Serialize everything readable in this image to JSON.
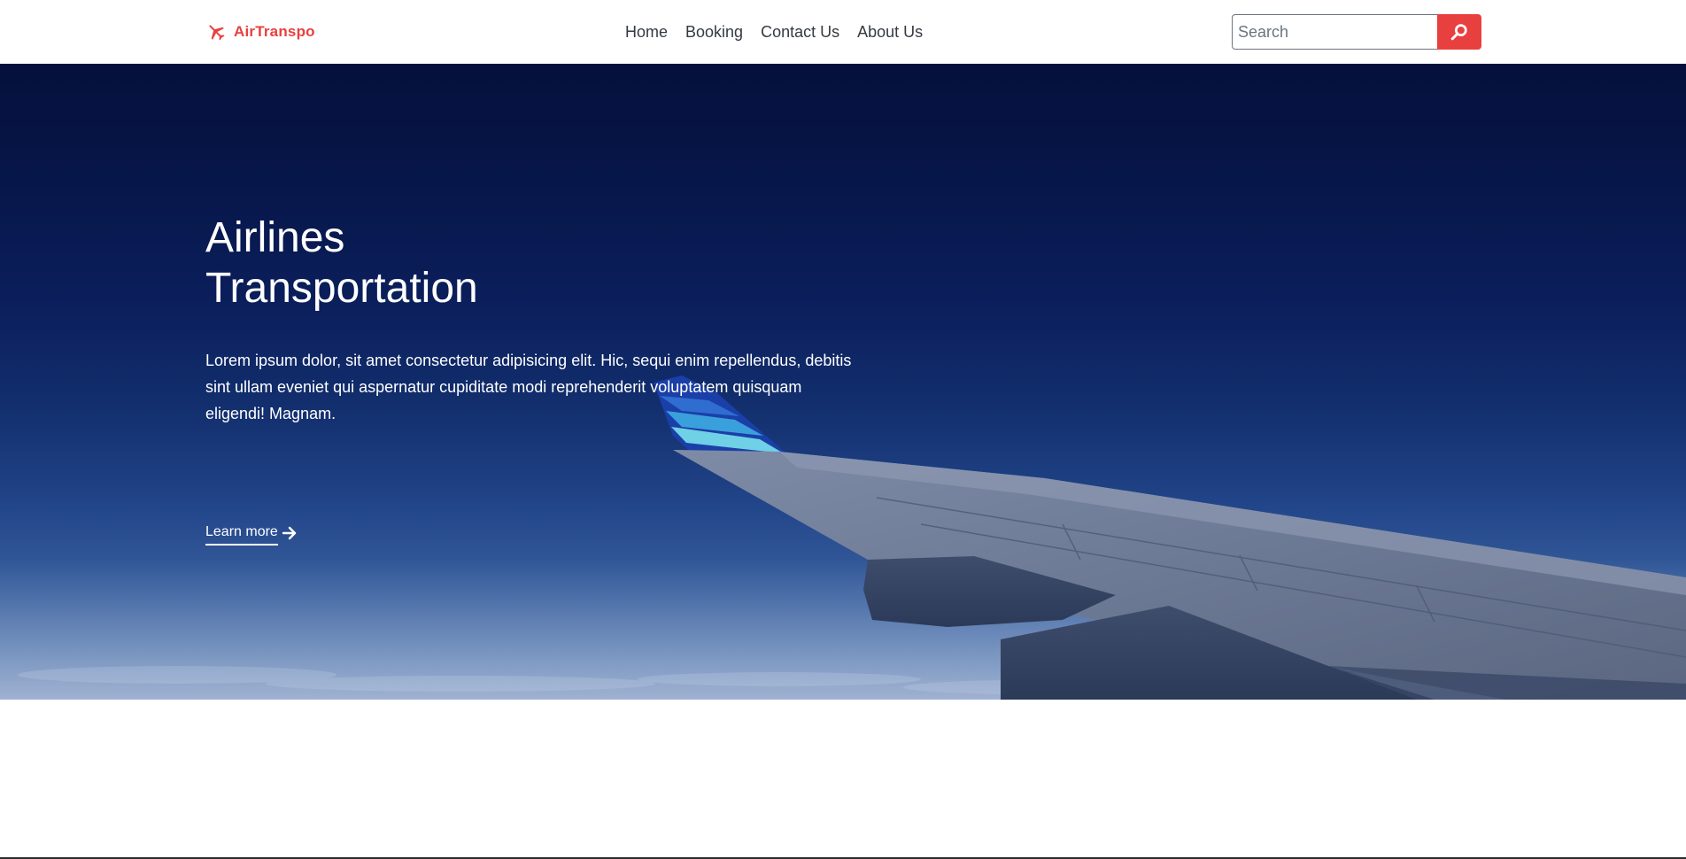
{
  "header": {
    "brand": {
      "name": "AirTranspo",
      "icon": "plane-icon",
      "color": "#e8403f"
    },
    "nav": [
      {
        "label": "Home"
      },
      {
        "label": "Booking"
      },
      {
        "label": "Contact Us"
      },
      {
        "label": "About Us"
      }
    ],
    "search": {
      "placeholder": "Search",
      "value": "",
      "button_icon": "search-icon"
    }
  },
  "hero": {
    "title_line1": "Airlines",
    "title_line2": "Transportation",
    "text": "Lorem ipsum dolor, sit amet consectetur adipisicing elit. Hic, sequi enim repellendus, debitis sint ullam eveniet qui aspernatur cupiditate modi reprehenderit voluptatem quisquam eligendi! Magnam.",
    "cta_label": "Learn more",
    "cta_icon": "arrow-right-icon",
    "background_image": "airplane wing over clouds, dark blue sky"
  },
  "colors": {
    "accent": "#e8403f",
    "nav_text": "#343a40",
    "hero_sky_top": "#05103b",
    "hero_sky_bottom": "#7893bf"
  }
}
